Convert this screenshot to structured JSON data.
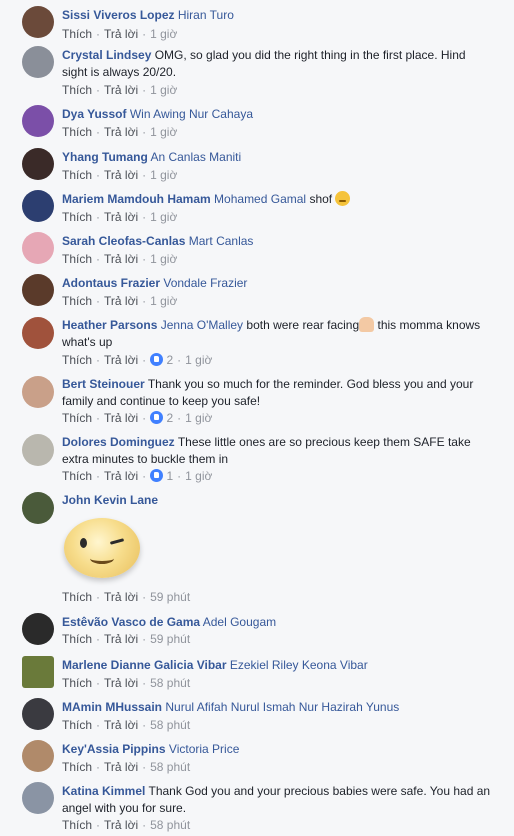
{
  "actions": {
    "like": "Thích",
    "reply": "Trả lời"
  },
  "comments": [
    {
      "name": "Sissi Viveros Lopez",
      "tags": "Hiran Turo",
      "text": "",
      "time": "1 giờ"
    },
    {
      "name": "Crystal Lindsey",
      "tags": "",
      "text": "OMG, so glad you did the right thing in the first place. Hind sight is always 20/20.",
      "time": "1 giờ"
    },
    {
      "name": "Dya Yussof",
      "tags": "Win Awing Nur Cahaya",
      "text": "",
      "time": "1 giờ"
    },
    {
      "name": "Yhang Tumang",
      "tags": "An Canlas Maniti",
      "text": "",
      "time": "1 giờ"
    },
    {
      "name": "Mariem Mamdouh Hamam",
      "tags": "Mohamed Gamal",
      "text": "shof",
      "time": "1 giờ"
    },
    {
      "name": "Sarah Cleofas-Canlas",
      "tags": "Mart Canlas",
      "text": "",
      "time": "1 giờ"
    },
    {
      "name": "Adontaus Frazier",
      "tags": "Vondale Frazier",
      "text": "",
      "time": "1 giờ"
    },
    {
      "name": "Heather Parsons",
      "tags": "Jenna O'Malley",
      "text": "both were rear facing",
      "text2": "this momma knows what's up",
      "likes": "2",
      "time": "1 giờ"
    },
    {
      "name": "Bert Steinouer",
      "tags": "",
      "text": "Thank you so much for the reminder. God bless you and your family and continue to keep you safe!",
      "likes": "2",
      "time": "1 giờ"
    },
    {
      "name": "Dolores Dominguez",
      "tags": "",
      "text": "These little ones are so precious keep them SAFE take extra minutes to buckle them in",
      "likes": "1",
      "time": "1 giờ"
    },
    {
      "name": "John Kevin Lane",
      "tags": "",
      "text": "",
      "time": "59 phút"
    },
    {
      "name": "Estêvão Vasco de Gama",
      "tags": "Adel Gougam",
      "text": "",
      "time": "59 phút"
    },
    {
      "name": "Marlene Dianne Galicia Vibar",
      "tags": "Ezekiel Riley Keona Vibar",
      "text": "",
      "time": "58 phút"
    },
    {
      "name": "MAmin MHussain",
      "tags": "Nurul Afifah Nurul Ismah Nur Hazirah Yunus",
      "text": "",
      "time": "58 phút"
    },
    {
      "name": "Key'Assia Pippins",
      "tags": "Victoria Price",
      "text": "",
      "time": "58 phút"
    },
    {
      "name": "Katina Kimmel",
      "tags": "",
      "text": "Thank God you and your precious babies were safe. You had an angel with you for sure.",
      "time": "58 phút"
    }
  ],
  "colors": {
    "link": "#365899",
    "meta": "#90949c",
    "like": "#4080ff",
    "bg": "#f6f7f9"
  }
}
